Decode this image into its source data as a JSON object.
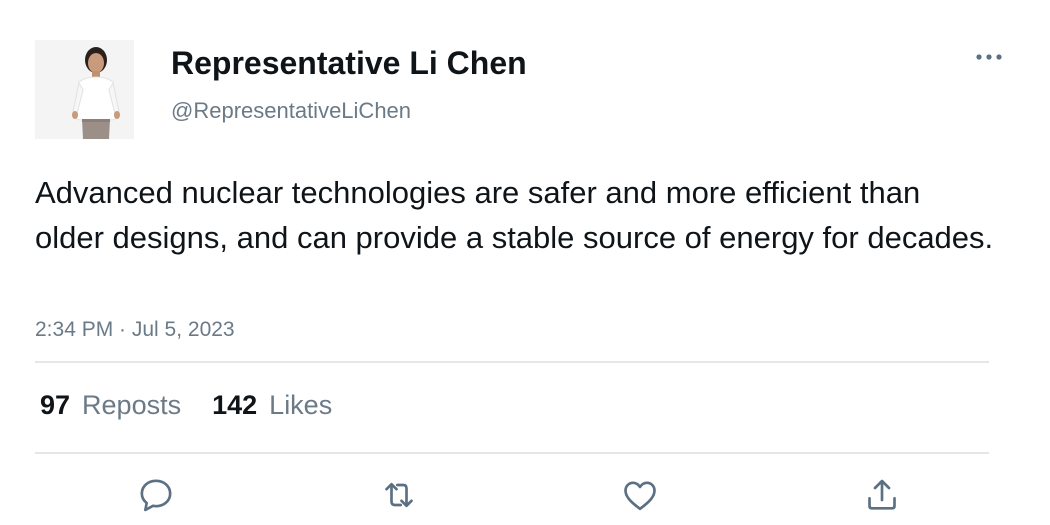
{
  "user": {
    "display_name": "Representative Li Chen",
    "handle": "@RepresentativeLiChen"
  },
  "tweet": {
    "text": "Advanced nuclear technologies are safer and more efficient than older designs, and can provide a stable source of energy for decades.",
    "timestamp": "2:34 PM · Jul 5, 2023"
  },
  "stats": {
    "reposts_count": "97",
    "reposts_label": "Reposts",
    "likes_count": "142",
    "likes_label": "Likes"
  },
  "actions": {
    "icons": [
      "reply-icon",
      "repost-icon",
      "like-icon",
      "share-icon"
    ]
  },
  "colors": {
    "text": "#0f1419",
    "secondary": "#6b7a87",
    "divider": "#e4e7ea",
    "icon": "#5b7083"
  }
}
